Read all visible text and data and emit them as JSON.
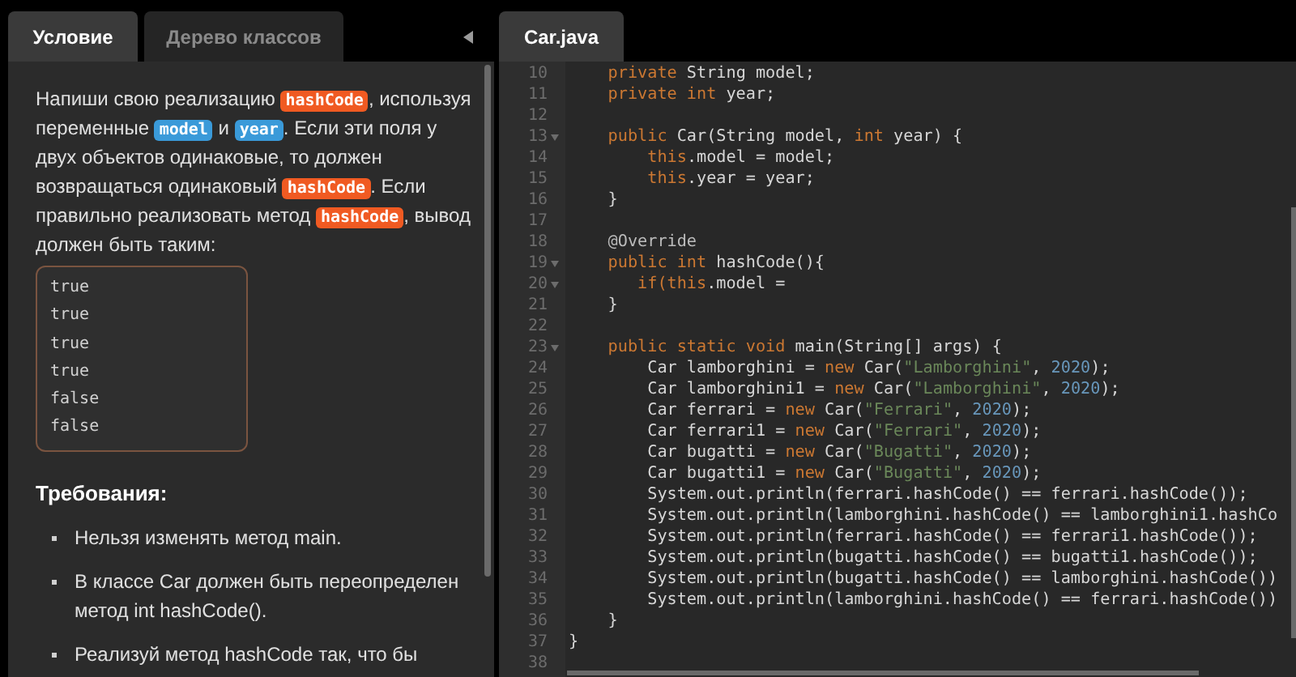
{
  "left_tabs": [
    {
      "label": "Условие",
      "selected": true
    },
    {
      "label": "Дерево классов",
      "selected": false
    }
  ],
  "task": {
    "paragraph": [
      {
        "text": "Напиши свою реализацию ",
        "kind": "plain"
      },
      {
        "text": "hashCode",
        "kind": "method"
      },
      {
        "text": ", используя переменные ",
        "kind": "plain"
      },
      {
        "text": "model",
        "kind": "field"
      },
      {
        "text": " и ",
        "kind": "plain"
      },
      {
        "text": "year",
        "kind": "field"
      },
      {
        "text": ". Если эти поля у двух объектов одинаковые, то должен возвращаться одинаковый ",
        "kind": "plain"
      },
      {
        "text": "hashCode",
        "kind": "method"
      },
      {
        "text": ". Если правильно реализовать метод ",
        "kind": "plain"
      },
      {
        "text": "hashCode",
        "kind": "method"
      },
      {
        "text": ", вывод должен быть таким:",
        "kind": "plain"
      }
    ],
    "output": [
      "true",
      "true",
      "true",
      "true",
      "false",
      "false"
    ],
    "requirements_title": "Требования:",
    "requirements": [
      "Нельзя изменять метод main.",
      "В классе Car должен быть переопределен метод int hashCode().",
      "Реализуй метод hashCode так, что бы"
    ]
  },
  "editor_tab": {
    "label": "Car.java",
    "selected": true
  },
  "code": [
    {
      "n": "10",
      "fold": false,
      "tokens": [
        {
          "t": "    private",
          "kind": "kw"
        },
        {
          "t": " String model;",
          "kind": "plain"
        }
      ]
    },
    {
      "n": "11",
      "fold": false,
      "tokens": [
        {
          "t": "    private int",
          "kind": "kw"
        },
        {
          "t": " year;",
          "kind": "plain"
        }
      ]
    },
    {
      "n": "12",
      "fold": false
    },
    {
      "n": "13",
      "fold": true,
      "tokens": [
        {
          "t": "    public",
          "kind": "kw"
        },
        {
          "t": " Car(String model,",
          "kind": "plain"
        },
        {
          "t": " int",
          "kind": "kw"
        },
        {
          "t": " year) {",
          "kind": "plain"
        }
      ]
    },
    {
      "n": "14",
      "fold": false,
      "tokens": [
        {
          "t": "        this",
          "kind": "kw"
        },
        {
          "t": ".model = model;",
          "kind": "plain"
        }
      ]
    },
    {
      "n": "15",
      "fold": false,
      "tokens": [
        {
          "t": "        this",
          "kind": "kw"
        },
        {
          "t": ".year = year;",
          "kind": "plain"
        }
      ]
    },
    {
      "n": "16",
      "fold": false,
      "tokens": [
        {
          "t": "    }",
          "kind": "plain"
        }
      ]
    },
    {
      "n": "17",
      "fold": false
    },
    {
      "n": "18",
      "fold": false,
      "tokens": [
        {
          "t": "    @Override",
          "kind": "ann"
        }
      ]
    },
    {
      "n": "19",
      "fold": true,
      "tokens": [
        {
          "t": "    public int",
          "kind": "kw"
        },
        {
          "t": " hashCode(){",
          "kind": "plain"
        }
      ]
    },
    {
      "n": "20",
      "fold": true,
      "tokens": [
        {
          "t": "       if(this",
          "kind": "kw"
        },
        {
          "t": ".model =",
          "kind": "plain"
        }
      ]
    },
    {
      "n": "21",
      "fold": false,
      "tokens": [
        {
          "t": "    }",
          "kind": "plain"
        }
      ]
    },
    {
      "n": "22",
      "fold": false
    },
    {
      "n": "23",
      "fold": true,
      "tokens": [
        {
          "t": "    public static void",
          "kind": "kw"
        },
        {
          "t": " main(String[] args) {",
          "kind": "plain"
        }
      ]
    },
    {
      "n": "24",
      "fold": false,
      "tokens": [
        {
          "t": "        Car lamborghini =",
          "kind": "plain"
        },
        {
          "t": " new",
          "kind": "kw"
        },
        {
          "t": " Car(",
          "kind": "plain"
        },
        {
          "t": "\"Lamborghini\"",
          "kind": "str"
        },
        {
          "t": ",",
          "kind": "plain"
        },
        {
          "t": " 2020",
          "kind": "num"
        },
        {
          "t": ");",
          "kind": "plain"
        }
      ]
    },
    {
      "n": "25",
      "fold": false,
      "tokens": [
        {
          "t": "        Car lamborghini1 =",
          "kind": "plain"
        },
        {
          "t": " new",
          "kind": "kw"
        },
        {
          "t": " Car(",
          "kind": "plain"
        },
        {
          "t": "\"Lamborghini\"",
          "kind": "str"
        },
        {
          "t": ",",
          "kind": "plain"
        },
        {
          "t": " 2020",
          "kind": "num"
        },
        {
          "t": ");",
          "kind": "plain"
        }
      ]
    },
    {
      "n": "26",
      "fold": false,
      "tokens": [
        {
          "t": "        Car ferrari =",
          "kind": "plain"
        },
        {
          "t": " new",
          "kind": "kw"
        },
        {
          "t": " Car(",
          "kind": "plain"
        },
        {
          "t": "\"Ferrari\"",
          "kind": "str"
        },
        {
          "t": ",",
          "kind": "plain"
        },
        {
          "t": " 2020",
          "kind": "num"
        },
        {
          "t": ");",
          "kind": "plain"
        }
      ]
    },
    {
      "n": "27",
      "fold": false,
      "tokens": [
        {
          "t": "        Car ferrari1 =",
          "kind": "plain"
        },
        {
          "t": " new",
          "kind": "kw"
        },
        {
          "t": " Car(",
          "kind": "plain"
        },
        {
          "t": "\"Ferrari\"",
          "kind": "str"
        },
        {
          "t": ",",
          "kind": "plain"
        },
        {
          "t": " 2020",
          "kind": "num"
        },
        {
          "t": ");",
          "kind": "plain"
        }
      ]
    },
    {
      "n": "28",
      "fold": false,
      "tokens": [
        {
          "t": "        Car bugatti =",
          "kind": "plain"
        },
        {
          "t": " new",
          "kind": "kw"
        },
        {
          "t": " Car(",
          "kind": "plain"
        },
        {
          "t": "\"Bugatti\"",
          "kind": "str"
        },
        {
          "t": ",",
          "kind": "plain"
        },
        {
          "t": " 2020",
          "kind": "num"
        },
        {
          "t": ");",
          "kind": "plain"
        }
      ]
    },
    {
      "n": "29",
      "fold": false,
      "tokens": [
        {
          "t": "        Car bugatti1 =",
          "kind": "plain"
        },
        {
          "t": " new",
          "kind": "kw"
        },
        {
          "t": " Car(",
          "kind": "plain"
        },
        {
          "t": "\"Bugatti\"",
          "kind": "str"
        },
        {
          "t": ",",
          "kind": "plain"
        },
        {
          "t": " 2020",
          "kind": "num"
        },
        {
          "t": ");",
          "kind": "plain"
        }
      ]
    },
    {
      "n": "30",
      "fold": false,
      "tokens": [
        {
          "t": "        System.out.println(ferrari.hashCode() == ferrari.hashCode());",
          "kind": "plain"
        }
      ]
    },
    {
      "n": "31",
      "fold": false,
      "tokens": [
        {
          "t": "        System.out.println(lamborghini.hashCode() == lamborghini1.hashCo",
          "kind": "plain"
        }
      ]
    },
    {
      "n": "32",
      "fold": false,
      "tokens": [
        {
          "t": "        System.out.println(ferrari.hashCode() == ferrari1.hashCode());",
          "kind": "plain"
        }
      ]
    },
    {
      "n": "33",
      "fold": false,
      "tokens": [
        {
          "t": "        System.out.println(bugatti.hashCode() == bugatti1.hashCode());",
          "kind": "plain"
        }
      ]
    },
    {
      "n": "34",
      "fold": false,
      "tokens": [
        {
          "t": "        System.out.println(bugatti.hashCode() == lamborghini.hashCode())",
          "kind": "plain"
        }
      ]
    },
    {
      "n": "35",
      "fold": false,
      "tokens": [
        {
          "t": "        System.out.println(lamborghini.hashCode() == ferrari.hashCode())",
          "kind": "plain"
        }
      ]
    },
    {
      "n": "36",
      "fold": false,
      "tokens": [
        {
          "t": "    }",
          "kind": "plain"
        }
      ]
    },
    {
      "n": "37",
      "fold": false,
      "tokens": [
        {
          "t": "}",
          "kind": "plain"
        }
      ]
    },
    {
      "n": "38",
      "fold": false
    }
  ]
}
